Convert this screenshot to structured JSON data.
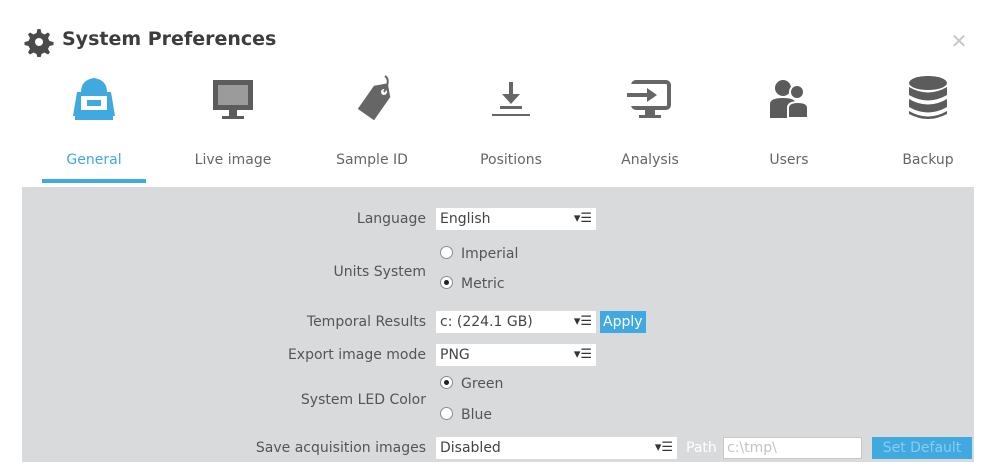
{
  "window": {
    "title": "System Preferences",
    "close_glyph": "✕",
    "accent_color": "#3fa9e0",
    "title_icon": "gear-icon"
  },
  "tabs": [
    {
      "label": "General",
      "icon": "general-icon",
      "active": true
    },
    {
      "label": "Live image",
      "icon": "monitor-icon",
      "active": false
    },
    {
      "label": "Sample ID",
      "icon": "tag-icon",
      "active": false
    },
    {
      "label": "Positions",
      "icon": "download-icon",
      "active": false
    },
    {
      "label": "Analysis",
      "icon": "export-icon",
      "active": false
    },
    {
      "label": "Users",
      "icon": "users-icon",
      "active": false
    },
    {
      "label": "Backup",
      "icon": "database-icon",
      "active": false
    }
  ],
  "form": {
    "language": {
      "label": "Language",
      "value": "English"
    },
    "units": {
      "label": "Units System",
      "options": [
        "Imperial",
        "Metric"
      ],
      "selected": "Metric"
    },
    "temporal": {
      "label": "Temporal Results",
      "value": "c: (224.1 GB)",
      "apply_label": "Apply"
    },
    "export_mode": {
      "label": "Export image mode",
      "value": "PNG"
    },
    "led": {
      "label": "System LED Color",
      "options": [
        "Green",
        "Blue"
      ],
      "selected": "Green"
    },
    "save_acq": {
      "label": "Save acquisition images",
      "value": "Disabled",
      "path_label": "Path",
      "path_value": "c:\\tmp\\",
      "set_default_label": "Set Default"
    }
  }
}
